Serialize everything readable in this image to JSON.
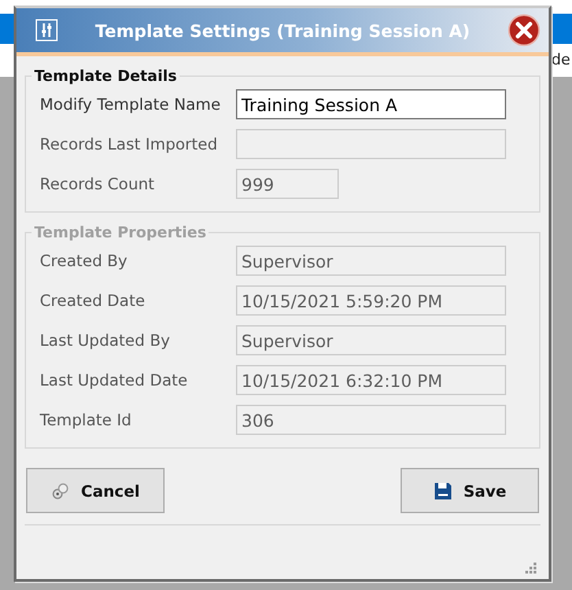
{
  "background": {
    "cell": "de"
  },
  "dialog": {
    "title": "Template Settings (Training Session A)",
    "groups": [
      {
        "legend": "Template Details",
        "disabled": false,
        "fields": [
          {
            "label": "Modify Template Name",
            "value": "Training Session A",
            "disabled": false,
            "kind": "long"
          },
          {
            "label": "Records Last Imported",
            "disabled": true,
            "kind": "long"
          },
          {
            "label": "Records Count",
            "value": "999",
            "disabled": true,
            "kind": "short"
          }
        ]
      },
      {
        "legend": "Template Properties",
        "disabled": true,
        "fields": [
          {
            "label": "Created By",
            "value": "Supervisor",
            "disabled": true,
            "kind": "long"
          },
          {
            "label": "Created Date",
            "value": "10/15/2021 5:59:20 PM",
            "disabled": true,
            "kind": "long"
          },
          {
            "label": "Last Updated By",
            "value": "Supervisor",
            "disabled": true,
            "kind": "long"
          },
          {
            "label": "Last Updated Date",
            "value": "10/15/2021 6:32:10 PM",
            "disabled": true,
            "kind": "long"
          },
          {
            "label": "Template Id",
            "value": "306",
            "disabled": true,
            "kind": "long"
          }
        ]
      }
    ],
    "buttons": [
      {
        "label": "Cancel",
        "kind": "cancel"
      },
      {
        "label": "Save",
        "kind": "save"
      }
    ]
  }
}
